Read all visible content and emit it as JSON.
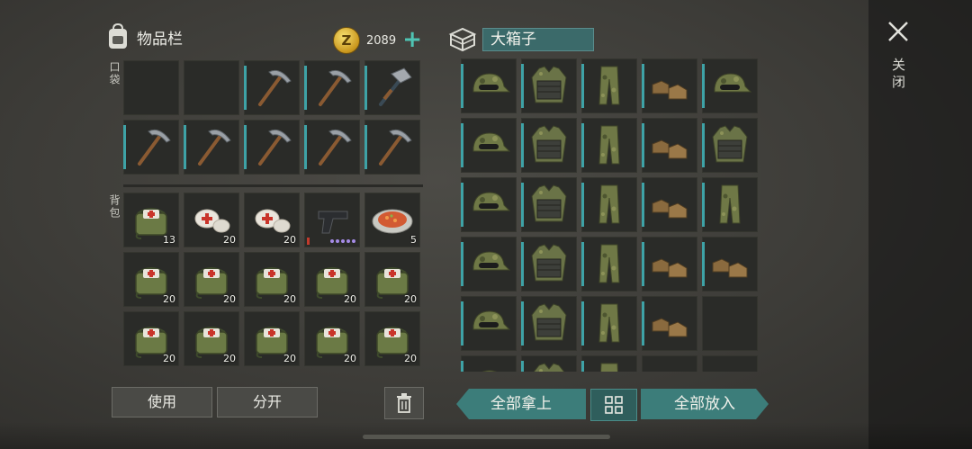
{
  "inventory": {
    "title": "物品栏",
    "pockets_label": "口袋",
    "backpack_label": "背包",
    "coins": "2089",
    "add_coins": "+",
    "coin_symbol": "Z"
  },
  "pockets": [
    {
      "item": "empty"
    },
    {
      "item": "empty"
    },
    {
      "item": "pickaxe"
    },
    {
      "item": "pickaxe"
    },
    {
      "item": "hammer"
    },
    {
      "item": "pickaxe"
    },
    {
      "item": "pickaxe"
    },
    {
      "item": "pickaxe"
    },
    {
      "item": "pickaxe"
    },
    {
      "item": "pickaxe"
    }
  ],
  "backpack": [
    {
      "item": "medkit",
      "qty": "13"
    },
    {
      "item": "bandage",
      "qty": "20"
    },
    {
      "item": "bandage",
      "qty": "20"
    },
    {
      "item": "pistol",
      "qty": ""
    },
    {
      "item": "food-plate",
      "qty": "5"
    },
    {
      "item": "medkit",
      "qty": "20"
    },
    {
      "item": "medkit",
      "qty": "20"
    },
    {
      "item": "medkit",
      "qty": "20"
    },
    {
      "item": "medkit",
      "qty": "20"
    },
    {
      "item": "medkit",
      "qty": "20"
    },
    {
      "item": "medkit",
      "qty": "20"
    },
    {
      "item": "medkit",
      "qty": "20"
    },
    {
      "item": "medkit",
      "qty": "20"
    },
    {
      "item": "medkit",
      "qty": "20"
    },
    {
      "item": "medkit",
      "qty": "20"
    }
  ],
  "box": {
    "name": "大箱子",
    "items": [
      "camo-cap",
      "camo-vest",
      "camo-pants",
      "boots",
      "camo-cap",
      "camo-cap",
      "camo-vest",
      "camo-pants",
      "boots",
      "camo-vest",
      "camo-cap",
      "camo-vest",
      "camo-pants",
      "boots",
      "camo-pants",
      "camo-cap",
      "camo-vest",
      "camo-pants",
      "boots",
      "boots",
      "camo-cap",
      "camo-vest",
      "camo-pants",
      "boots",
      "empty",
      "camo-cap",
      "camo-vest",
      "camo-pants",
      "empty",
      "empty"
    ]
  },
  "actions": {
    "use": "使用",
    "split": "分开",
    "take_all": "全部拿上",
    "put_all": "全部放入",
    "close": "关闭"
  },
  "colors": {
    "accent": "#3ea2a6",
    "button_teal": "#3c7d7a",
    "coin": "#e3b83a",
    "ammo": "#a58be6"
  }
}
